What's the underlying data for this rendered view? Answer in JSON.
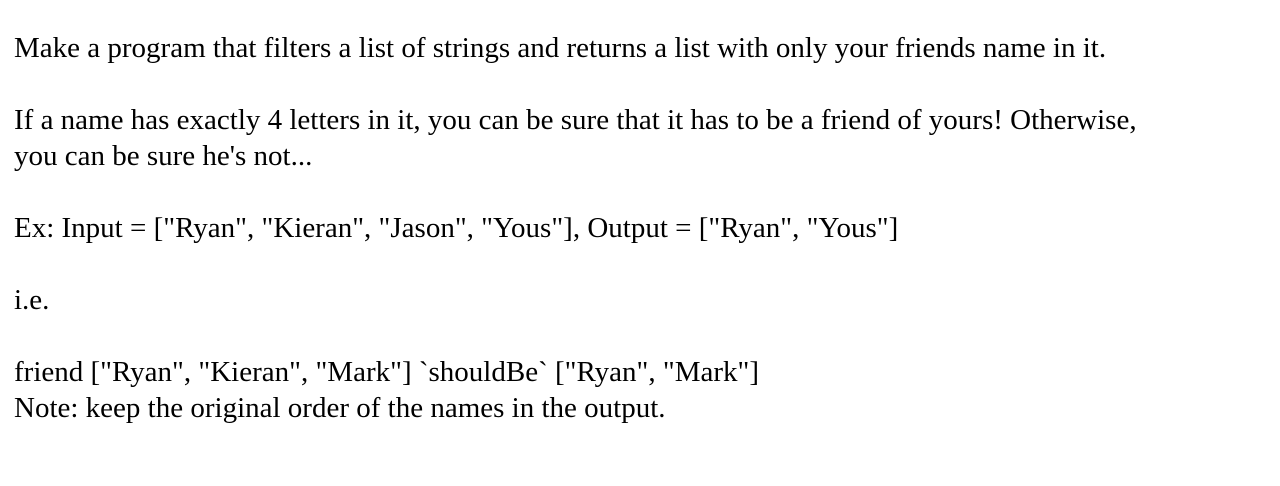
{
  "document": {
    "intro": "Make a program that filters a list of strings and returns a list with only your friends name in it.",
    "rule_line1": "If a name has exactly 4 letters in it, you can be sure that it has to be a friend of yours! Otherwise,",
    "rule_line2": "you can be sure he's not...",
    "example": "Ex: Input = [\"Ryan\", \"Kieran\", \"Jason\", \"Yous\"], Output = [\"Ryan\", \"Yous\"]",
    "ie": "i.e.",
    "code_line": "friend [\"Ryan\", \"Kieran\", \"Mark\"] `shouldBe` [\"Ryan\", \"Mark\"]",
    "note": "Note: keep the original order of the names in the output."
  }
}
